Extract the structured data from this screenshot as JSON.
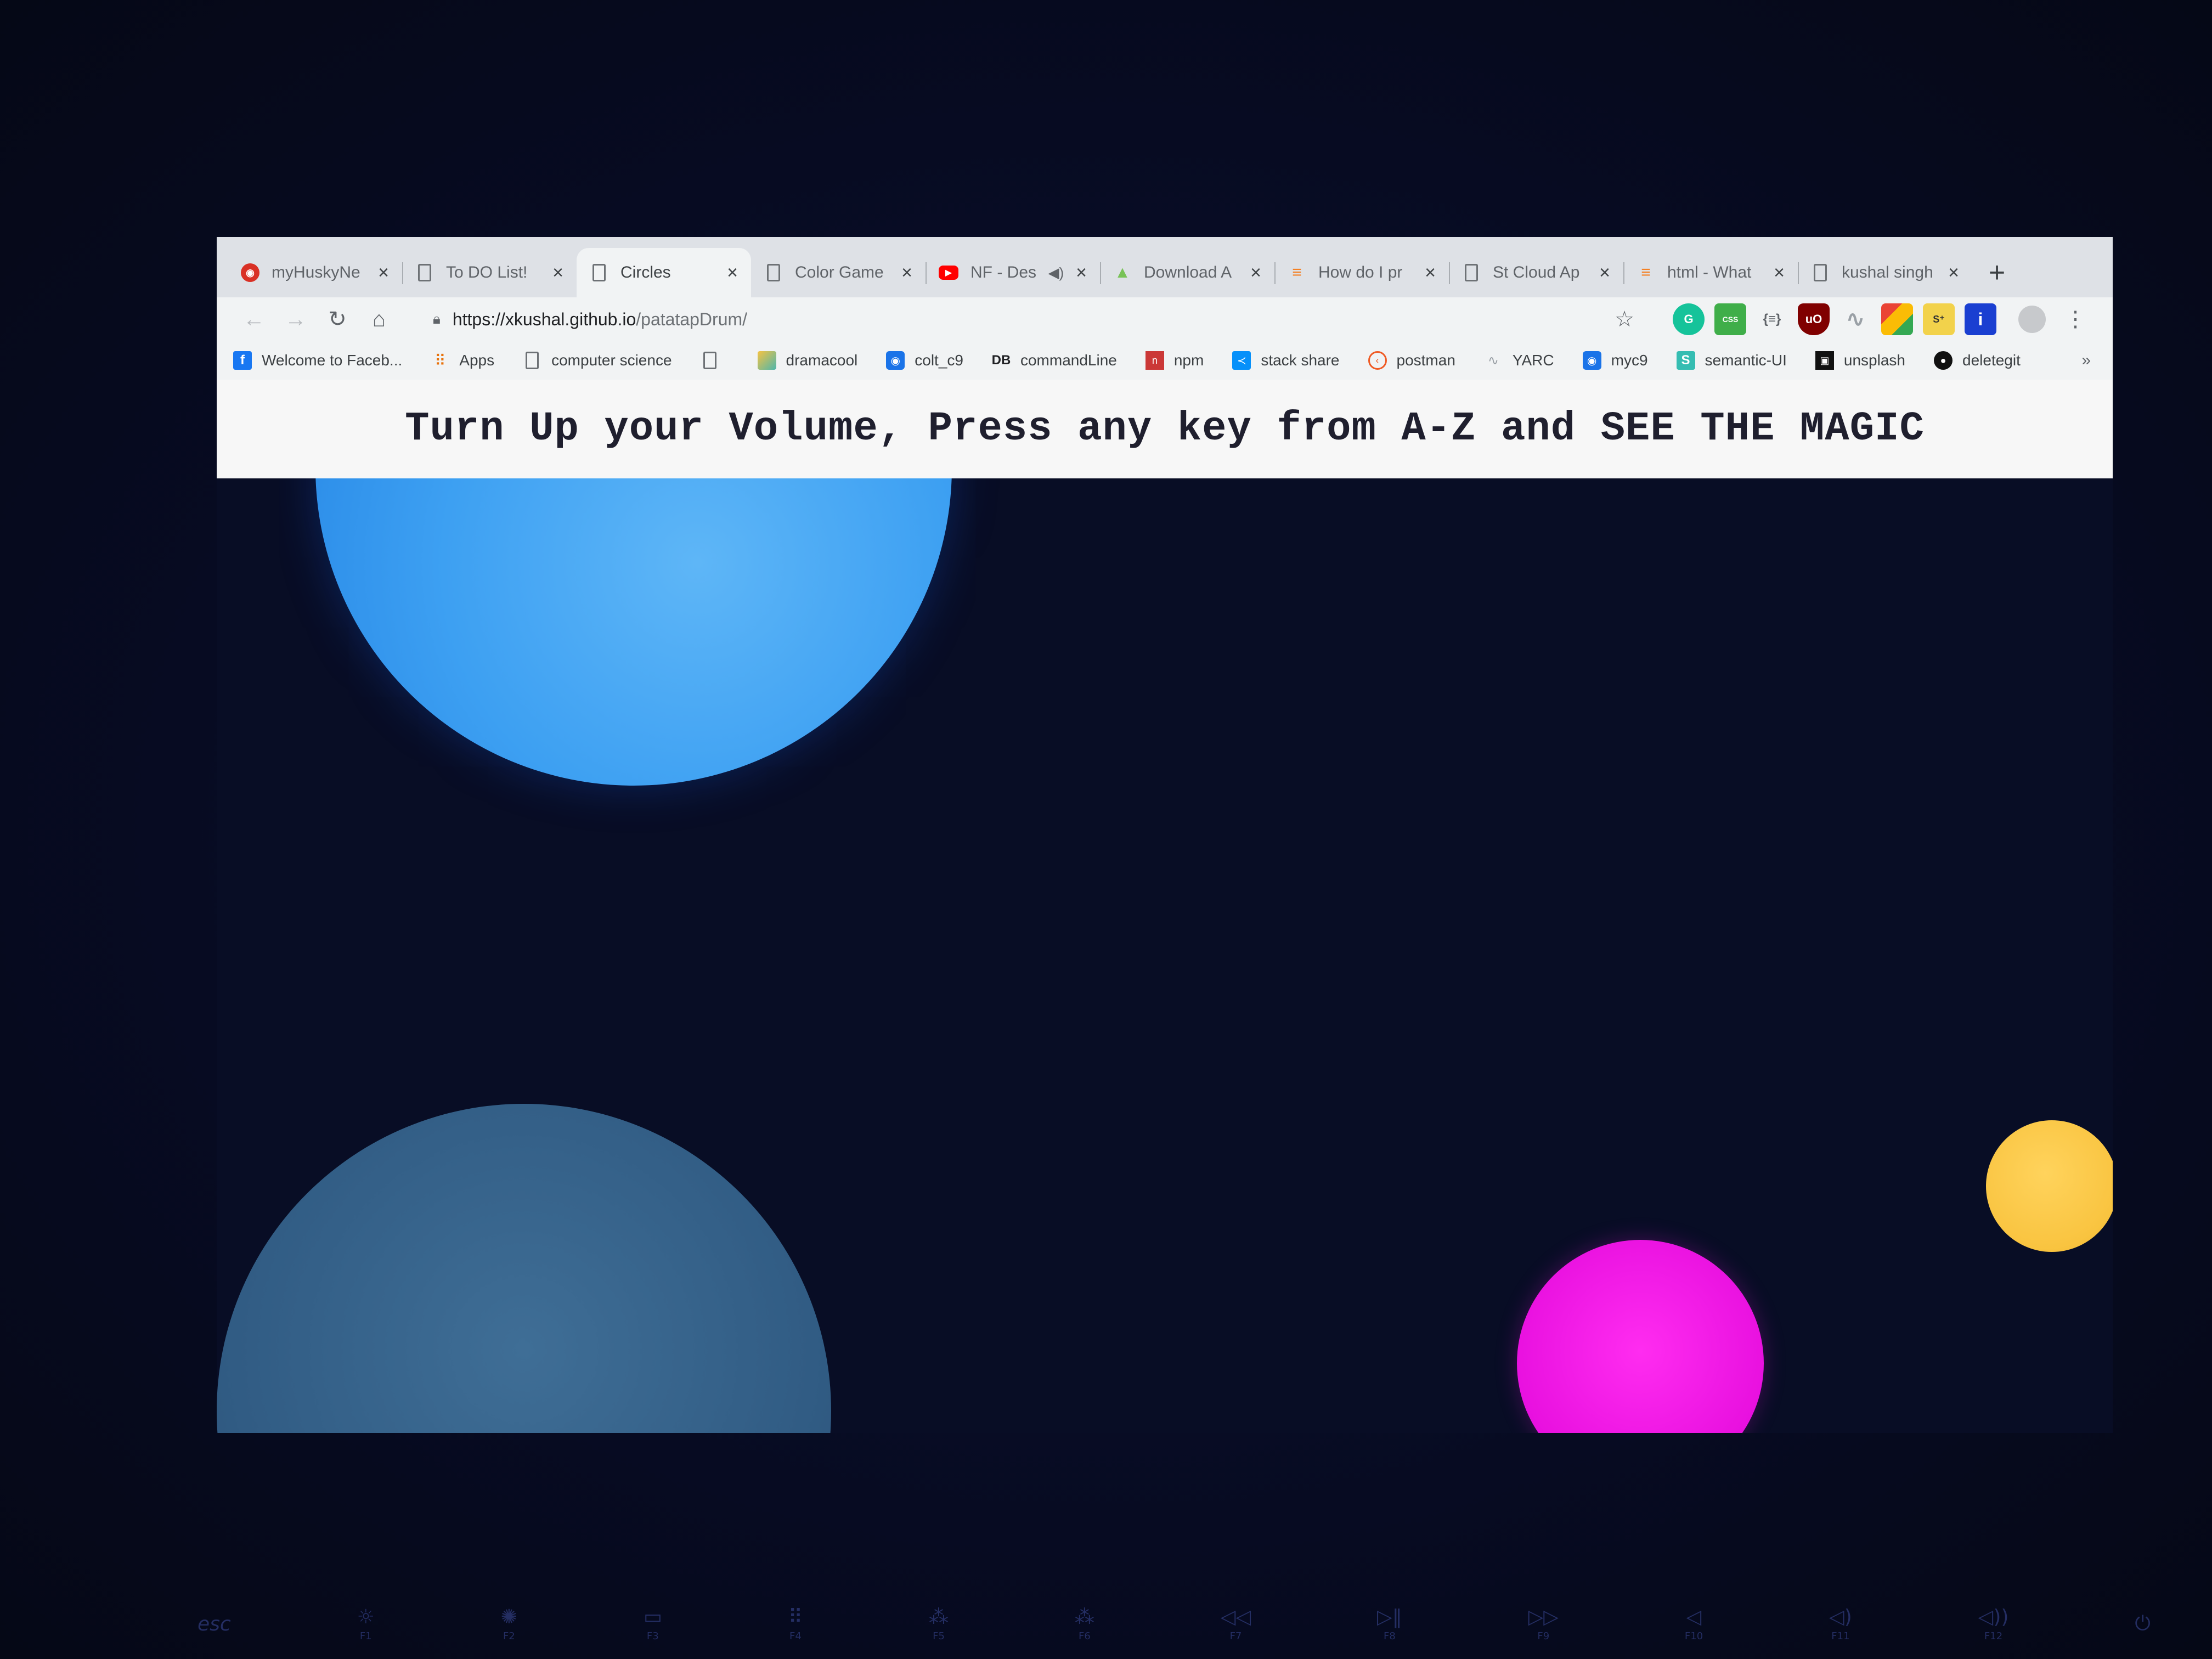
{
  "browser": {
    "tabs": [
      {
        "title": "myHuskyNe",
        "favicon": "husky-red-icon",
        "active": false,
        "audio": false
      },
      {
        "title": "To DO List!",
        "favicon": "document-icon",
        "active": false,
        "audio": false
      },
      {
        "title": "Circles",
        "favicon": "document-icon",
        "active": true,
        "audio": false
      },
      {
        "title": "Color Game",
        "favicon": "document-icon",
        "active": false,
        "audio": false
      },
      {
        "title": "NF - Des",
        "favicon": "youtube-icon",
        "active": false,
        "audio": true
      },
      {
        "title": "Download A",
        "favicon": "android-icon",
        "active": false,
        "audio": false
      },
      {
        "title": "How do I pr",
        "favicon": "stackoverflow-icon",
        "active": false,
        "audio": false
      },
      {
        "title": "St Cloud Ap",
        "favicon": "document-icon",
        "active": false,
        "audio": false
      },
      {
        "title": "html - What",
        "favicon": "stackoverflow-icon",
        "active": false,
        "audio": false
      },
      {
        "title": "kushal singh",
        "favicon": "document-icon",
        "active": false,
        "audio": false
      }
    ],
    "url": {
      "host": "https://xkushal.github.io",
      "path": "/patatapDrum/"
    },
    "bookmarks": [
      {
        "label": "Welcome to Faceb...",
        "icon": "facebook-icon"
      },
      {
        "label": "Apps",
        "icon": "apps-grid-icon"
      },
      {
        "label": "computer science",
        "icon": "document-icon"
      },
      {
        "label": "",
        "icon": "document-icon"
      },
      {
        "label": "dramacool",
        "icon": "dramacool-icon"
      },
      {
        "label": "colt_c9",
        "icon": "eye-icon"
      },
      {
        "label": "commandLine",
        "icon": "db-icon"
      },
      {
        "label": "npm",
        "icon": "npm-icon"
      },
      {
        "label": "stack share",
        "icon": "stackshare-icon"
      },
      {
        "label": "postman",
        "icon": "postman-icon"
      },
      {
        "label": "YARC",
        "icon": "yarc-icon"
      },
      {
        "label": "myc9",
        "icon": "eye-icon"
      },
      {
        "label": "semantic-UI",
        "icon": "semantic-icon"
      },
      {
        "label": "unsplash",
        "icon": "unsplash-icon"
      },
      {
        "label": "deletegit",
        "icon": "github-icon"
      }
    ]
  },
  "page": {
    "headline": "Turn Up your Volume, Press any key from A-Z and SEE THE MAGIC",
    "circle_colors": {
      "blue": "#3da0f2",
      "teal": "#315c84",
      "magenta": "#e810df",
      "yellow": "#f9c440"
    },
    "background": "#080d25"
  },
  "keyboard": {
    "esc": "esc",
    "fkeys": [
      "F1",
      "F2",
      "F3",
      "F4",
      "F5",
      "F6",
      "F7",
      "F8",
      "F9",
      "F10",
      "F11",
      "F12"
    ]
  }
}
